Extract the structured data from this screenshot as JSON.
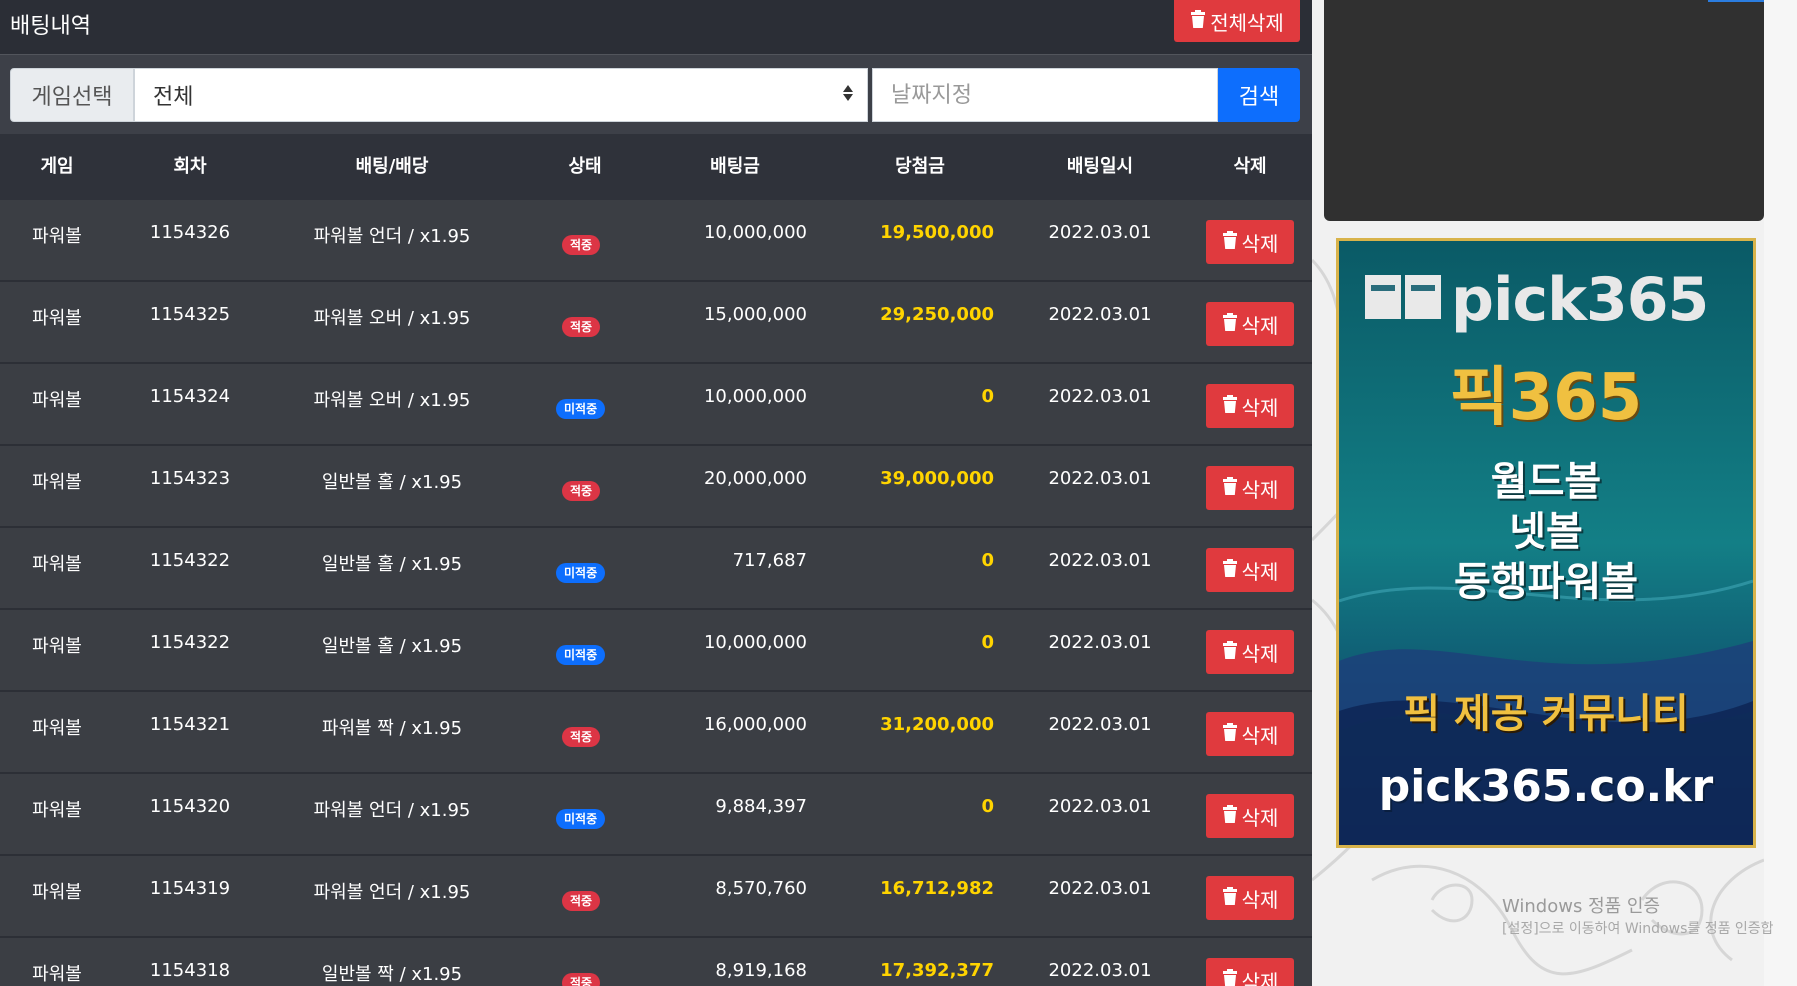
{
  "header": {
    "title": "배팅내역",
    "delete_all_label": "전체삭제"
  },
  "filter": {
    "game_label": "게임선택",
    "game_selected": "전체",
    "date_placeholder": "날짜지정",
    "search_label": "검색"
  },
  "table": {
    "columns": [
      "게임",
      "회차",
      "배팅/배당",
      "상태",
      "배팅금",
      "당첨금",
      "배팅일시",
      "삭제"
    ],
    "delete_label": "삭제",
    "rows": [
      {
        "game": "파워볼",
        "round": "1154326",
        "bet": "파워볼 언더 / x1.95",
        "status": "적중",
        "amount": "10,000,000",
        "winnings": "19,500,000",
        "date": "2022.03.01"
      },
      {
        "game": "파워볼",
        "round": "1154325",
        "bet": "파워볼 오버 / x1.95",
        "status": "적중",
        "amount": "15,000,000",
        "winnings": "29,250,000",
        "date": "2022.03.01"
      },
      {
        "game": "파워볼",
        "round": "1154324",
        "bet": "파워볼 오버 / x1.95",
        "status": "미적중",
        "amount": "10,000,000",
        "winnings": "0",
        "date": "2022.03.01"
      },
      {
        "game": "파워볼",
        "round": "1154323",
        "bet": "일반볼 홀 / x1.95",
        "status": "적중",
        "amount": "20,000,000",
        "winnings": "39,000,000",
        "date": "2022.03.01"
      },
      {
        "game": "파워볼",
        "round": "1154322",
        "bet": "일반볼 홀 / x1.95",
        "status": "미적중",
        "amount": "717,687",
        "winnings": "0",
        "date": "2022.03.01"
      },
      {
        "game": "파워볼",
        "round": "1154322",
        "bet": "일반볼 홀 / x1.95",
        "status": "미적중",
        "amount": "10,000,000",
        "winnings": "0",
        "date": "2022.03.01"
      },
      {
        "game": "파워볼",
        "round": "1154321",
        "bet": "파워볼 짝 / x1.95",
        "status": "적중",
        "amount": "16,000,000",
        "winnings": "31,200,000",
        "date": "2022.03.01"
      },
      {
        "game": "파워볼",
        "round": "1154320",
        "bet": "파워볼 언더 / x1.95",
        "status": "미적중",
        "amount": "9,884,397",
        "winnings": "0",
        "date": "2022.03.01"
      },
      {
        "game": "파워볼",
        "round": "1154319",
        "bet": "파워볼 언더 / x1.95",
        "status": "적중",
        "amount": "8,570,760",
        "winnings": "16,712,982",
        "date": "2022.03.01"
      },
      {
        "game": "파워볼",
        "round": "1154318",
        "bet": "일반볼 짝 / x1.95",
        "status": "적중",
        "amount": "8,919,168",
        "winnings": "17,392,377",
        "date": "2022.03.01"
      }
    ]
  },
  "banner": {
    "brand": "pick365",
    "brand_ko": "픽365",
    "games": [
      "월드볼",
      "넷볼",
      "동행파워볼"
    ],
    "tagline": "픽 제공 커뮤니티",
    "url": "pick365.co.kr"
  },
  "windows_notice": {
    "title": "Windows 정품 인증",
    "subtitle": "[설정]으로 이동하여 Windows를 정품 인증합"
  },
  "colors": {
    "panel_bg": "#3b3e44",
    "header_bg": "#2b2e36",
    "danger": "#e03a3e",
    "primary": "#0d6efd",
    "winnings": "#ffd400"
  }
}
